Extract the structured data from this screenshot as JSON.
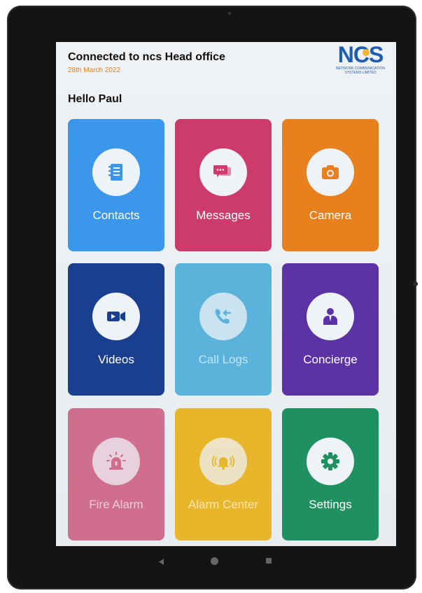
{
  "header": {
    "title": "Connected to ncs Head office",
    "date": "28th March 2022",
    "greeting": "Hello Paul"
  },
  "logo": {
    "mark": "NCS",
    "subtitle": "NETWORK COMMUNICATION SYSTEMS LIMITED"
  },
  "tiles": [
    {
      "label": "Contacts",
      "color": "#3a97ec",
      "icon": "contacts-book-icon"
    },
    {
      "label": "Messages",
      "color": "#cc3b6b",
      "icon": "chat-bubbles-icon"
    },
    {
      "label": "Camera",
      "color": "#e8801e",
      "icon": "camera-icon"
    },
    {
      "label": "Videos",
      "color": "#1b3f8f",
      "icon": "video-camera-icon"
    },
    {
      "label": "Call Logs",
      "color": "#5bb3dc",
      "icon": "call-log-icon"
    },
    {
      "label": "Concierge",
      "color": "#5b33a5",
      "icon": "concierge-person-icon"
    },
    {
      "label": "Fire Alarm",
      "color": "#d06e8e",
      "icon": "siren-icon"
    },
    {
      "label": "Alarm Center",
      "color": "#e8b62a",
      "icon": "alarm-bell-icon"
    },
    {
      "label": "Settings",
      "color": "#1f9160",
      "icon": "gear-icon"
    }
  ],
  "nav": {
    "back_icon": "back-triangle-icon",
    "home_icon": "home-circle-icon",
    "recents_icon": "recents-square-icon"
  }
}
